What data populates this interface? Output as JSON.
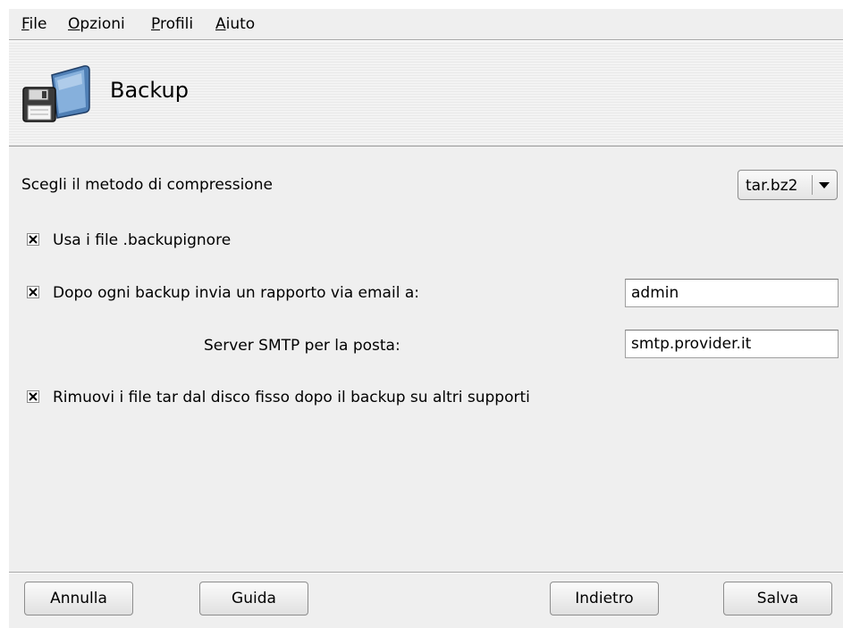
{
  "menubar": {
    "items": [
      {
        "mnemonic": "F",
        "rest": "ile"
      },
      {
        "mnemonic": "O",
        "rest": "pzioni"
      },
      {
        "mnemonic": "P",
        "rest": "rofili"
      },
      {
        "mnemonic": "A",
        "rest": "iuto"
      }
    ]
  },
  "banner": {
    "title": "Backup",
    "icon": "backup-floppy-folder-icon"
  },
  "compression": {
    "label": "Scegli il metodo di compressione",
    "selected": "tar.bz2"
  },
  "options": {
    "use_backupignore": {
      "label": "Usa i file .backupignore",
      "checked": true
    },
    "email_report": {
      "label": "Dopo ogni backup invia un rapporto via email a:",
      "checked": true,
      "value": "admin"
    },
    "smtp": {
      "label": "Server SMTP per la posta:",
      "value": "smtp.provider.it"
    },
    "remove_tar": {
      "label": "Rimuovi i file tar dal disco fisso dopo il backup su altri supporti",
      "checked": true
    }
  },
  "buttons": {
    "cancel": "Annulla",
    "help": "Guida",
    "back": "Indietro",
    "save": "Salva"
  }
}
